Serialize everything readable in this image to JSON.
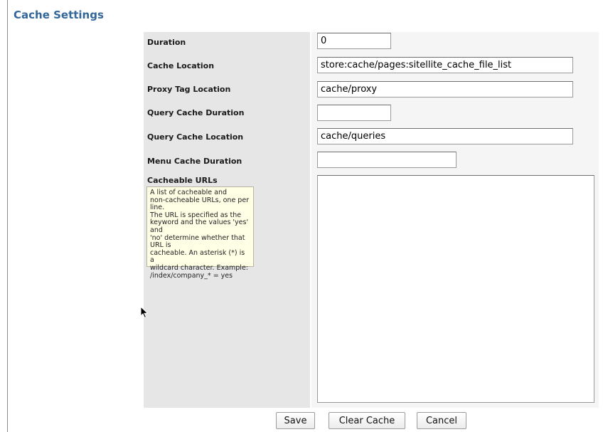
{
  "page": {
    "title": "Cache Settings"
  },
  "fields": [
    {
      "label": "Duration",
      "value": "0"
    },
    {
      "label": "Cache Location",
      "value": "store:cache/pages:sitellite_cache_file_list"
    },
    {
      "label": "Proxy Tag Location",
      "value": "cache/proxy"
    },
    {
      "label": "Query Cache Duration",
      "value": ""
    },
    {
      "label": "Query Cache Location",
      "value": "cache/queries"
    },
    {
      "label": "Menu Cache Duration",
      "value": ""
    }
  ],
  "cacheable_urls": {
    "label": "Cacheable URLs",
    "help_lines": [
      "A list of cacheable and",
      "non-cacheable URLs, one per line.",
      "The URL is specified as the",
      "keyword and the values 'yes' and",
      "'no' determine whether that URL is",
      "cacheable. An asterisk (*) is a",
      "wildcard character. Example:",
      "/index/company_* = yes"
    ],
    "value": ""
  },
  "buttons": {
    "save": "Save",
    "clear_cache": "Clear Cache",
    "cancel": "Cancel"
  },
  "icons": {
    "cursor": "arrow-cursor-icon"
  },
  "colors": {
    "title": "#336699",
    "label_column": "#e6e6e6",
    "help_background": "#ffffe6"
  }
}
